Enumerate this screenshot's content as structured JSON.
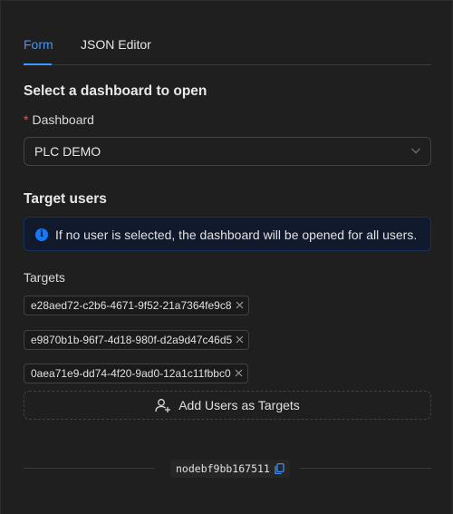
{
  "tabs": [
    {
      "label": "Form"
    },
    {
      "label": "JSON Editor"
    }
  ],
  "dashboard_section": {
    "title": "Select a dashboard to open",
    "required_mark": "*",
    "field_label": "Dashboard",
    "selected_value": "PLC DEMO"
  },
  "target_section": {
    "title": "Target users",
    "info_text": "If no user is selected, the dashboard will be opened for all users.",
    "targets_label": "Targets",
    "targets": [
      "e28aed72-c2b6-4671-9f52-21a7364fe9c8",
      "e9870b1b-96f7-4d18-980f-d2a9d47c46d5",
      "0aea71e9-dd74-4f20-9ad0-12a1c11fbbc0"
    ],
    "add_button_label": "Add Users as Targets"
  },
  "footer": {
    "node_id": "nodebf9bb167511"
  },
  "colors": {
    "accent": "#4096ff",
    "required": "#ff4d4f",
    "info": "#1677ff"
  }
}
